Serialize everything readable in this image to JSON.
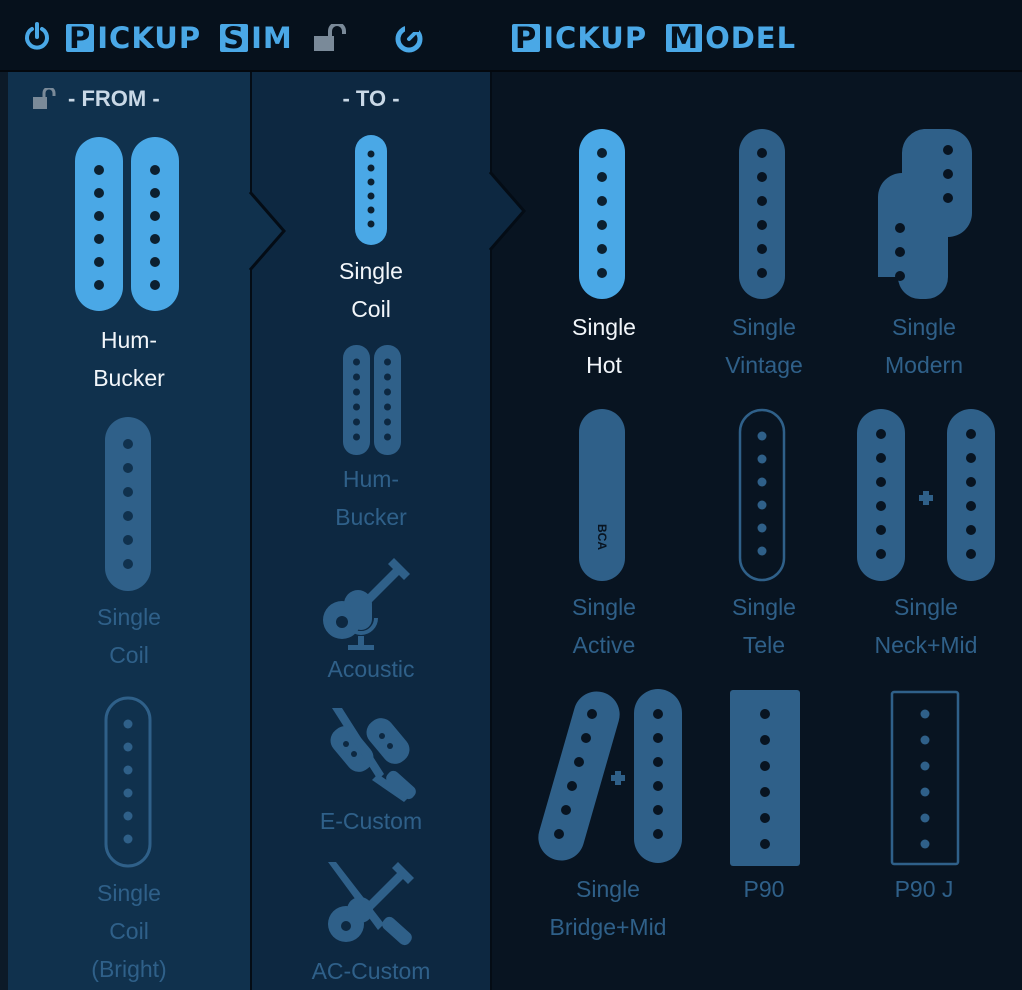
{
  "header": {
    "sim_title_first": "P",
    "sim_title_rest": "ICKUP",
    "sim_title_first2": "S",
    "sim_title_rest2": "IM",
    "model_title_first": "P",
    "model_title_rest": "ICKUP",
    "model_title_first2": "M",
    "model_title_rest2": "ODEL"
  },
  "from": {
    "heading": "- FROM -",
    "items": [
      {
        "label": "Hum-\nBucker",
        "selected": true
      },
      {
        "label": "Single\nCoil",
        "selected": false
      },
      {
        "label": "Single\nCoil\n(Bright)",
        "selected": false
      }
    ]
  },
  "to": {
    "heading": "- TO -",
    "items": [
      {
        "label": "Single\nCoil",
        "selected": true
      },
      {
        "label": "Hum-\nBucker",
        "selected": false
      },
      {
        "label": "Acoustic",
        "selected": false
      },
      {
        "label": "E-Custom",
        "selected": false
      },
      {
        "label": "AC-Custom",
        "selected": false
      }
    ]
  },
  "model": {
    "items": [
      {
        "label": "Single\nHot",
        "selected": true
      },
      {
        "label": "Single\nVintage",
        "selected": false
      },
      {
        "label": "Single\nModern",
        "selected": false
      },
      {
        "label": "Single\nActive",
        "selected": false,
        "badge": "BCA"
      },
      {
        "label": "Single\nTele",
        "selected": false
      },
      {
        "label": "Single\nNeck+Mid",
        "selected": false
      },
      {
        "label": "Single\nBridge+Mid",
        "selected": false
      },
      {
        "label": "P90",
        "selected": false
      },
      {
        "label": "P90 J",
        "selected": false
      }
    ]
  },
  "colors": {
    "accent": "#4aa8e6",
    "inactive": "#2f6089",
    "from_bg": "#10314d",
    "to_bg": "#0d2841",
    "model_bg": "#081421",
    "header_bg": "#06111c"
  }
}
